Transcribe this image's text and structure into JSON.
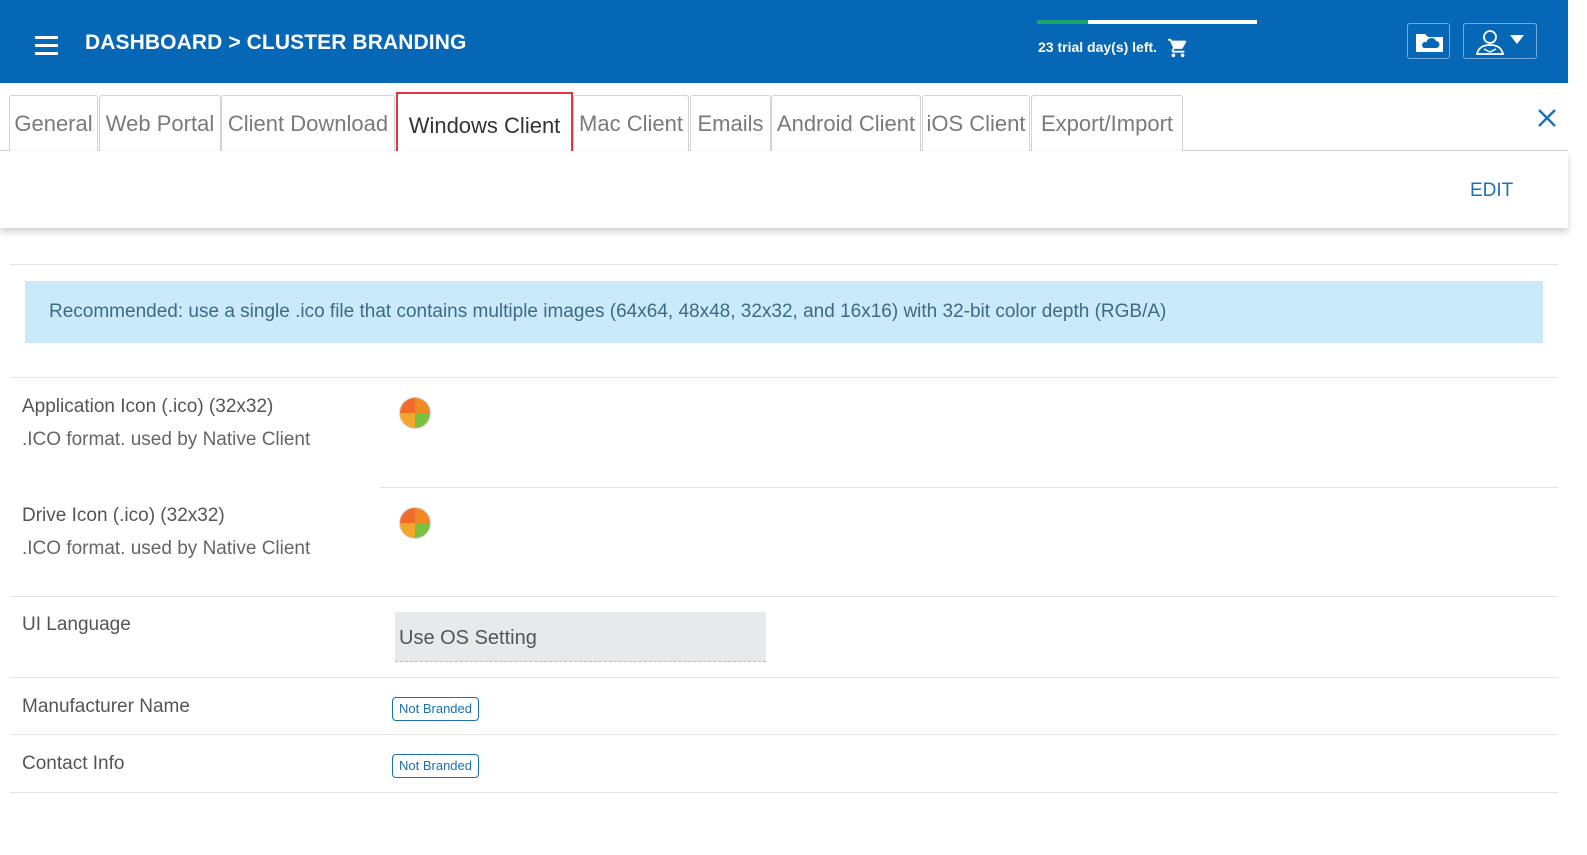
{
  "header": {
    "breadcrumb": "DASHBOARD > CLUSTER BRANDING",
    "trial_text": "23 trial day(s) left.",
    "trial_progress": 0.23,
    "colors": {
      "bar": "#0667b7",
      "progress": "#1aa56b"
    },
    "icons": {
      "menu": "hamburger-menu-icon",
      "cart": "cart-icon",
      "cloud": "cloud-folder-icon",
      "user": "user-icon",
      "dropdown": "caret-down-icon"
    }
  },
  "tabs": [
    {
      "label": "General"
    },
    {
      "label": "Web Portal"
    },
    {
      "label": "Client Download"
    },
    {
      "label": "Windows Client",
      "active": true
    },
    {
      "label": "Mac Client"
    },
    {
      "label": "Emails"
    },
    {
      "label": "Android Client"
    },
    {
      "label": "iOS Client"
    },
    {
      "label": "Export/Import"
    }
  ],
  "toolbar": {
    "edit_label": "EDIT",
    "close_icon": "close-icon"
  },
  "info": {
    "text": "Recommended: use a single .ico file that contains multiple images (64x64, 48x48, 32x32, and 16x16) with 32-bit color depth (RGB/A)"
  },
  "settings": {
    "app_icon": {
      "label": "Application Icon (.ico) (32x32)",
      "sub": ".ICO format. used by Native Client"
    },
    "drive_icon": {
      "label": "Drive Icon (.ico) (32x32)",
      "sub": ".ICO format. used by Native Client"
    },
    "ui_language": {
      "label": "UI Language",
      "value": "Use OS Setting"
    },
    "manufacturer": {
      "label": "Manufacturer Name",
      "badge": "Not Branded"
    },
    "contact": {
      "label": "Contact Info",
      "badge": "Not Branded"
    }
  }
}
